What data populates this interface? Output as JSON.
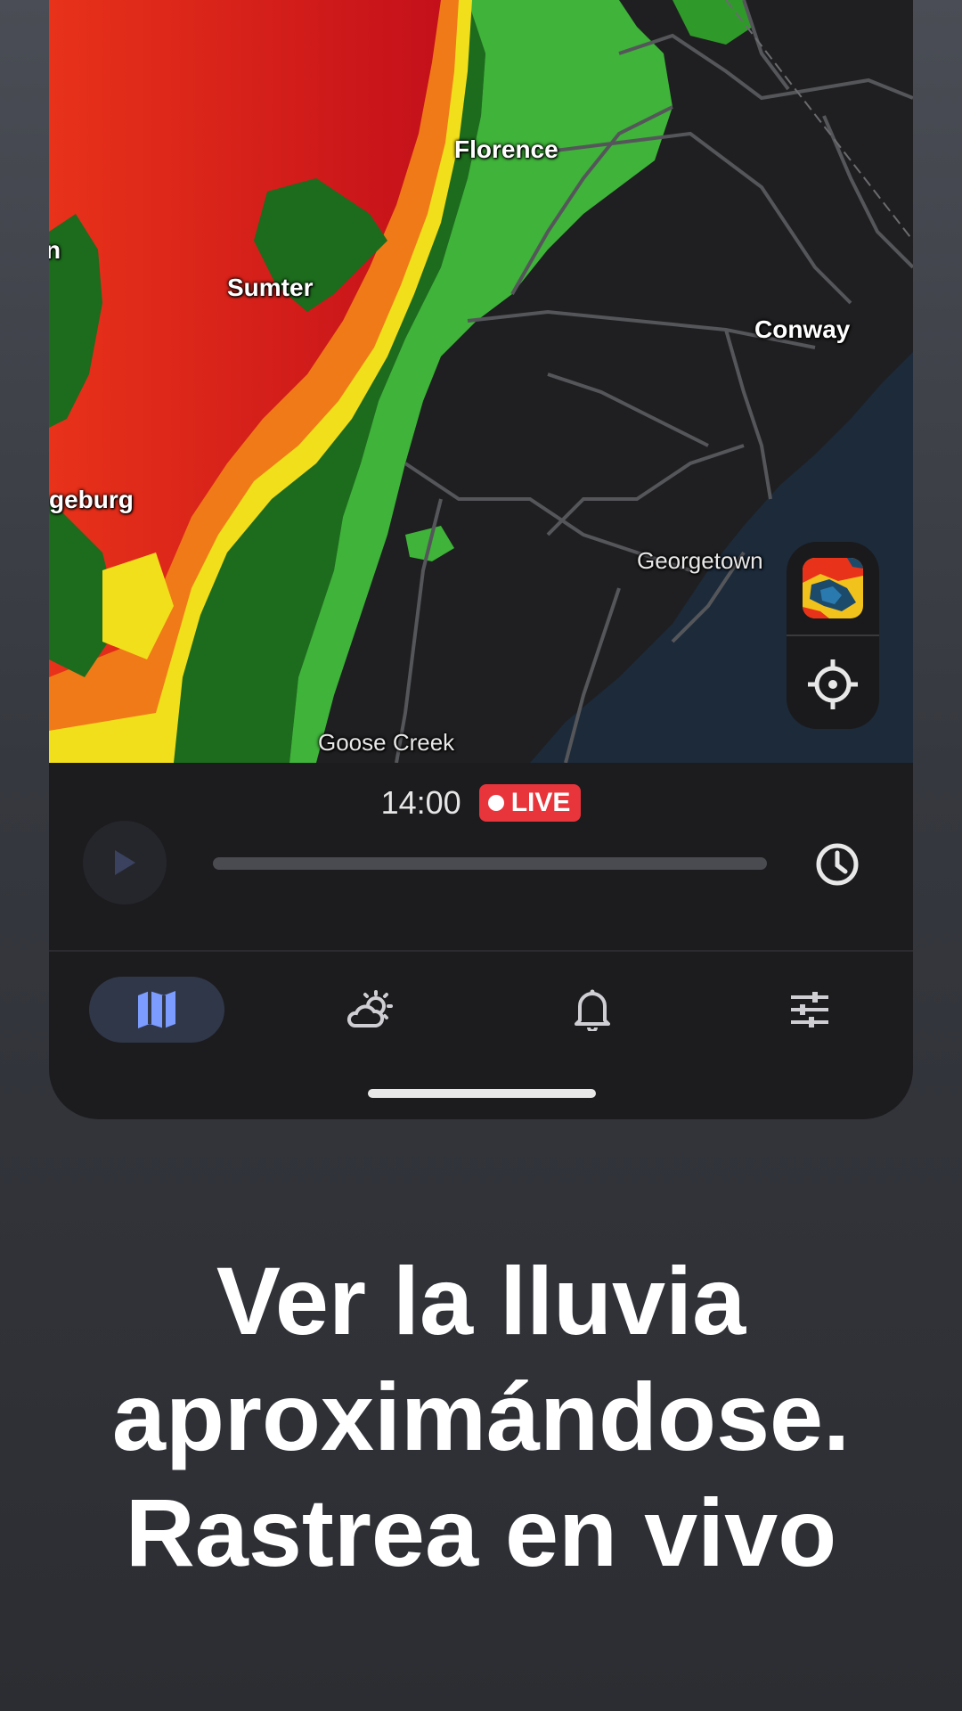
{
  "map": {
    "cities": {
      "florence": "Florence",
      "sumter": "Sumter",
      "conway": "Conway",
      "orangeburg_partial": "geburg",
      "left_edge_partial": "n",
      "georgetown": "Georgetown",
      "goose_creek": "Goose Creek"
    },
    "controls": {
      "layer_icon": "radar-layer-thumbnail",
      "locate_icon": "crosshair-icon"
    }
  },
  "player": {
    "time": "14:00",
    "live_label": "LIVE",
    "play_icon": "play-icon",
    "history_icon": "clock-icon"
  },
  "navbar": {
    "items": [
      {
        "icon": "map-icon",
        "active": true
      },
      {
        "icon": "partly-cloudy-icon",
        "active": false
      },
      {
        "icon": "bell-icon",
        "active": false
      },
      {
        "icon": "sliders-icon",
        "active": false
      }
    ]
  },
  "caption": {
    "line1": "Ver la lluvia",
    "line2": "aproximándose.",
    "line3": "Rastrea en vivo"
  },
  "colors": {
    "accent": "#7c9cff",
    "live_red": "#e8343b",
    "radar_red": "#d8141a",
    "radar_yellow": "#f4e21a",
    "radar_green": "#2f9a2a",
    "ocean": "#1c2a3a"
  }
}
